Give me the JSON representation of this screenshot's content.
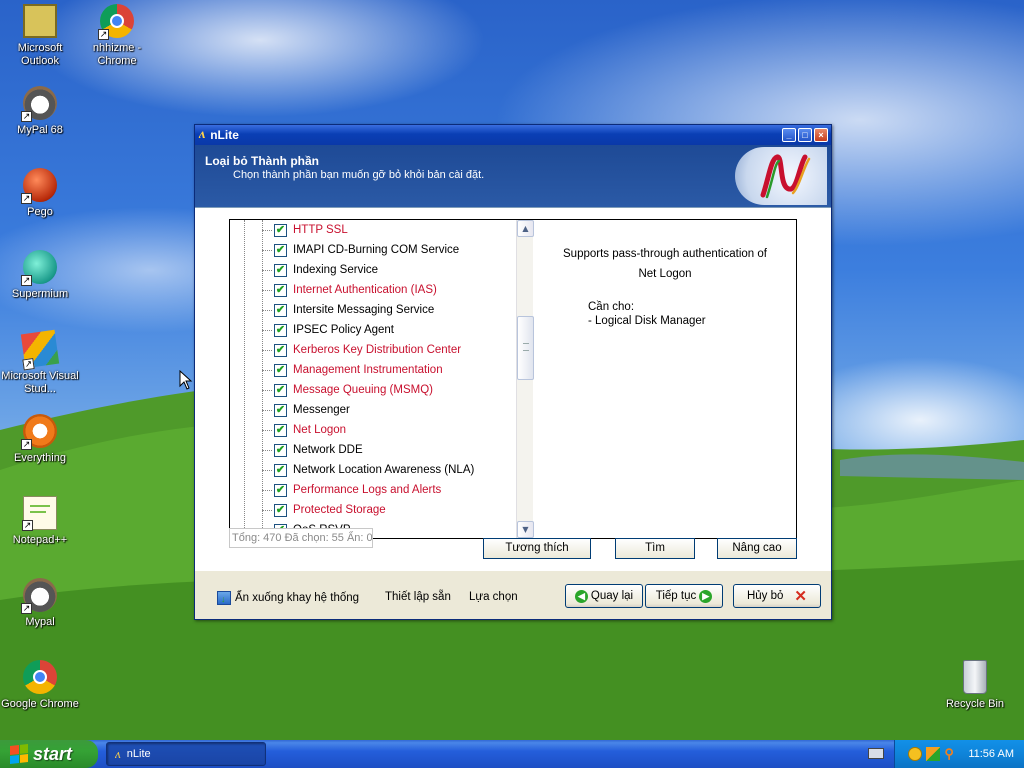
{
  "desktop": {
    "icons": [
      {
        "label": "Microsoft Outlook"
      },
      {
        "label": "nhhizme - Chrome"
      },
      {
        "label": "MyPal 68"
      },
      {
        "label": "Pego"
      },
      {
        "label": "Supermium"
      },
      {
        "label": "Microsoft Visual Stud..."
      },
      {
        "label": "Everything"
      },
      {
        "label": "Notepad++"
      },
      {
        "label": "Mypal"
      },
      {
        "label": "Google Chrome"
      },
      {
        "label": "Recycle Bin"
      }
    ]
  },
  "window": {
    "title": "nLite",
    "header_title": "Loại bỏ Thành phần",
    "header_subtitle": "Chọn thành phần bạn muốn gỡ bỏ khỏi bản cài đặt.",
    "components": [
      {
        "label": "HTTP SSL",
        "checked": true,
        "color": "#c8102e"
      },
      {
        "label": "IMAPI CD-Burning COM Service",
        "checked": true,
        "color": "#000000"
      },
      {
        "label": "Indexing Service",
        "checked": true,
        "color": "#000000"
      },
      {
        "label": "Internet Authentication (IAS)",
        "checked": true,
        "color": "#c8102e"
      },
      {
        "label": "Intersite Messaging Service",
        "checked": true,
        "color": "#000000"
      },
      {
        "label": "IPSEC Policy Agent",
        "checked": true,
        "color": "#000000"
      },
      {
        "label": "Kerberos Key Distribution Center",
        "checked": true,
        "color": "#c8102e"
      },
      {
        "label": "Management Instrumentation",
        "checked": true,
        "color": "#c8102e"
      },
      {
        "label": "Message Queuing (MSMQ)",
        "checked": true,
        "color": "#c8102e"
      },
      {
        "label": "Messenger",
        "checked": true,
        "color": "#000000"
      },
      {
        "label": "Net Logon",
        "checked": true,
        "color": "#c8102e"
      },
      {
        "label": "Network DDE",
        "checked": true,
        "color": "#000000"
      },
      {
        "label": "Network Location Awareness (NLA)",
        "checked": true,
        "color": "#000000"
      },
      {
        "label": "Performance Logs and Alerts",
        "checked": true,
        "color": "#c8102e"
      },
      {
        "label": "Protected Storage",
        "checked": true,
        "color": "#c8102e"
      },
      {
        "label": "QoS RSVP",
        "checked": true,
        "color": "#000000"
      }
    ],
    "description": {
      "line1": "Supports pass-through authentication of",
      "line2": "Net Logon",
      "needed_by_label": "Cần cho:",
      "needed_by_item": " - Logical Disk Manager"
    },
    "status": "Tổng: 470 Đã chọn: 55 Ẩn: 0",
    "buttons": {
      "compat": "Tương thích",
      "find": "Tìm",
      "advanced": "Nâng cao",
      "back": "Quay lại",
      "next": "Tiếp tục",
      "cancel": "Hủy bỏ"
    },
    "footer_links": {
      "minimize_tray": "Ẩn xuống khay hệ thống",
      "presets": "Thiết lập sẵn",
      "options": "Lựa chọn"
    }
  },
  "taskbar": {
    "start_label": "start",
    "task_label": "nLite",
    "clock": "11:56 AM"
  }
}
